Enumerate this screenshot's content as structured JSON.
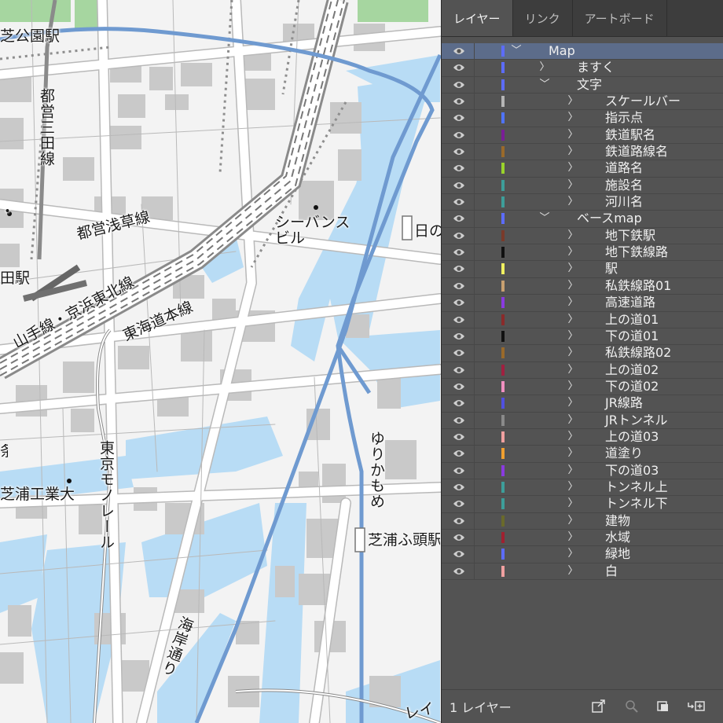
{
  "map": {
    "labels": {
      "shiba_koen_station": "芝公園駅",
      "toei_mita_line": "都営三田線",
      "toei_asakusa_line": "都営浅草線",
      "seavans_building": "シーバンス\nビル",
      "hinode_partial": "日の",
      "tamachi_station_partial": "田駅",
      "yamanote_keihin_line": "山手線・京浜東北線",
      "tokaido_line": "東海道本線",
      "tokyo_monorail": "東京モノレール",
      "yurikamome": "ゆりかもめ",
      "shibaura_it_univ": "芝浦工業大",
      "shibaura_futo_partial": "芝浦ふ頭駅",
      "kaigan_dori": "海岸通り",
      "partial_left_1": "・",
      "partial_left_2": "条",
      "partial_bottom": "レイ"
    }
  },
  "panel": {
    "tabs": [
      {
        "label": "レイヤー",
        "active": true
      },
      {
        "label": "リンク",
        "active": false
      },
      {
        "label": "アートボード",
        "active": false
      }
    ],
    "layers": [
      {
        "name": "Map",
        "color": "#5c6cff",
        "depth": 0,
        "expanded": true,
        "selected": true
      },
      {
        "name": "ますく",
        "color": "#5c6cff",
        "depth": 1,
        "expanded": false
      },
      {
        "name": "文字",
        "color": "#5c6cff",
        "depth": 1,
        "expanded": true
      },
      {
        "name": "スケールバー",
        "color": "#b5b5b5",
        "depth": 2,
        "expanded": false
      },
      {
        "name": "指示点",
        "color": "#4f73ff",
        "depth": 2,
        "expanded": false
      },
      {
        "name": "鉄道駅名",
        "color": "#7a1e96",
        "depth": 2,
        "expanded": false
      },
      {
        "name": "鉄道路線名",
        "color": "#9a6a2a",
        "depth": 2,
        "expanded": false
      },
      {
        "name": "道路名",
        "color": "#9ad32b",
        "depth": 2,
        "expanded": false
      },
      {
        "name": "施設名",
        "color": "#3d9e9a",
        "depth": 2,
        "expanded": false
      },
      {
        "name": "河川名",
        "color": "#3d9e9a",
        "depth": 2,
        "expanded": false
      },
      {
        "name": "ベースmap",
        "color": "#5c6cff",
        "depth": 1,
        "expanded": true
      },
      {
        "name": "地下鉄駅",
        "color": "#7a3a2a",
        "depth": 2,
        "expanded": false
      },
      {
        "name": "地下鉄線路",
        "color": "#111111",
        "depth": 2,
        "expanded": false
      },
      {
        "name": "駅",
        "color": "#f0f060",
        "depth": 2,
        "expanded": false
      },
      {
        "name": "私鉄線路01",
        "color": "#c8a070",
        "depth": 2,
        "expanded": false
      },
      {
        "name": "高速道路",
        "color": "#8a3ae0",
        "depth": 2,
        "expanded": false
      },
      {
        "name": "上の道01",
        "color": "#8a2a2a",
        "depth": 2,
        "expanded": false
      },
      {
        "name": "下の道01",
        "color": "#111111",
        "depth": 2,
        "expanded": false
      },
      {
        "name": "私鉄線路02",
        "color": "#9a6a2a",
        "depth": 2,
        "expanded": false
      },
      {
        "name": "上の道02",
        "color": "#a02040",
        "depth": 2,
        "expanded": false
      },
      {
        "name": "下の道02",
        "color": "#f090c0",
        "depth": 2,
        "expanded": false
      },
      {
        "name": "JR線路",
        "color": "#5050e0",
        "depth": 2,
        "expanded": false
      },
      {
        "name": "JRトンネル",
        "color": "#8a8a8a",
        "depth": 2,
        "expanded": false
      },
      {
        "name": "上の道03",
        "color": "#f0a0a0",
        "depth": 2,
        "expanded": false
      },
      {
        "name": "道塗り",
        "color": "#f0a030",
        "depth": 2,
        "expanded": false
      },
      {
        "name": "下の道03",
        "color": "#8a3ae0",
        "depth": 2,
        "expanded": false
      },
      {
        "name": "トンネル上",
        "color": "#3d9e9a",
        "depth": 2,
        "expanded": false
      },
      {
        "name": "トンネル下",
        "color": "#3d9e9a",
        "depth": 2,
        "expanded": false
      },
      {
        "name": "建物",
        "color": "#6a6a2a",
        "depth": 2,
        "expanded": false
      },
      {
        "name": "水域",
        "color": "#a02030",
        "depth": 2,
        "expanded": false
      },
      {
        "name": "緑地",
        "color": "#5c6cff",
        "depth": 2,
        "expanded": false
      },
      {
        "name": "白",
        "color": "#f0a0a0",
        "depth": 2,
        "expanded": false
      }
    ],
    "footer": {
      "layer_count": "1 レイヤー",
      "icons": [
        "export-icon",
        "search-icon",
        "clipping-mask-icon",
        "new-sublayer-icon"
      ]
    }
  }
}
